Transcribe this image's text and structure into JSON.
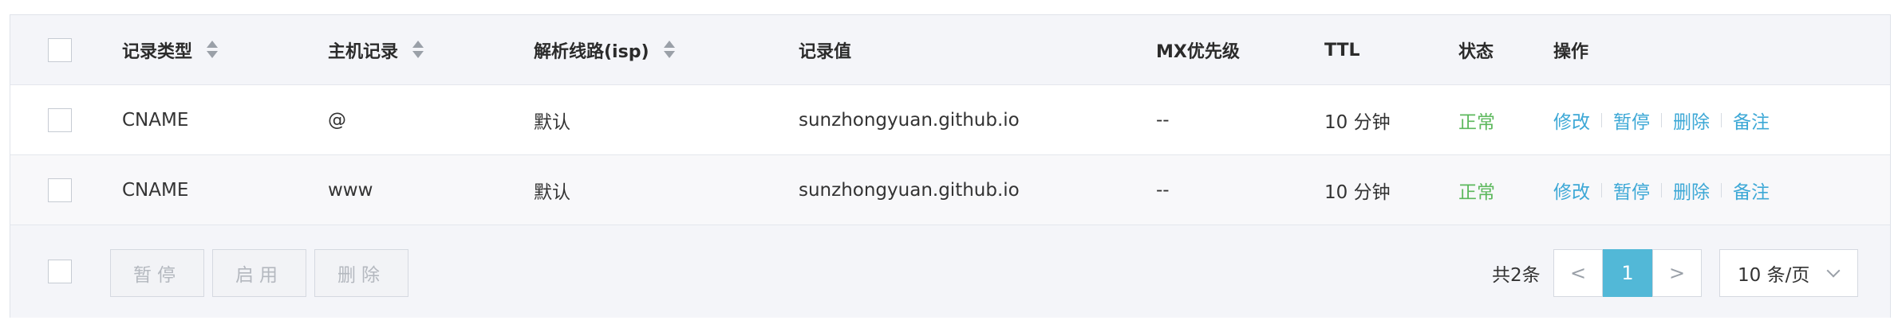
{
  "table": {
    "headers": {
      "record_type": "记录类型",
      "host": "主机记录",
      "line": "解析线路(isp)",
      "value": "记录值",
      "mx": "MX优先级",
      "ttl": "TTL",
      "status": "状态",
      "actions": "操作"
    },
    "rows": [
      {
        "record_type": "CNAME",
        "host": "@",
        "line": "默认",
        "value": "sunzhongyuan.github.io",
        "mx": "--",
        "ttl": "10 分钟",
        "status": "正常",
        "actions": [
          "修改",
          "暂停",
          "删除",
          "备注"
        ]
      },
      {
        "record_type": "CNAME",
        "host": "www",
        "line": "默认",
        "value": "sunzhongyuan.github.io",
        "mx": "--",
        "ttl": "10 分钟",
        "status": "正常",
        "actions": [
          "修改",
          "暂停",
          "删除",
          "备注"
        ]
      }
    ]
  },
  "footer": {
    "bulk_pause": "暂停",
    "bulk_enable": "启用",
    "bulk_delete": "删除",
    "total": "共2条",
    "prev": "<",
    "current_page": "1",
    "next": ">",
    "page_size": "10 条/页"
  },
  "colors": {
    "link": "#3da8d6",
    "status_ok": "#5cb85c",
    "active_page": "#52b8d7"
  }
}
